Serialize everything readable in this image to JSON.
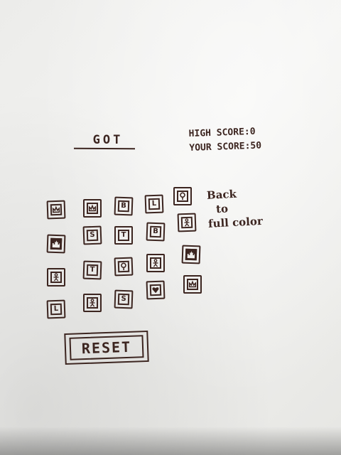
{
  "game": {
    "title": "GOT",
    "high_score_label": "HIGH SCORE:",
    "high_score": "0",
    "your_score_label": "YOUR SCORE:",
    "your_score": "50",
    "note_line1": "Back",
    "note_line2": "to",
    "note_line3": "full color",
    "reset_label": "RESET"
  },
  "tiles": [
    {
      "icon": "crown-icon"
    },
    {
      "icon": "crown-icon"
    },
    {
      "text": "B"
    },
    {
      "text": "L"
    },
    {
      "icon": "tree-icon"
    },
    {
      "icon": "castle-icon",
      "filled": true
    },
    {
      "text": "S"
    },
    {
      "text": "T"
    },
    {
      "text": "B"
    },
    {
      "icon": "figure-icon"
    },
    {
      "icon": "figure-icon"
    },
    {
      "text": "T"
    },
    {
      "icon": "tree-icon"
    },
    {
      "icon": "figure-icon"
    },
    {
      "icon": "castle-icon",
      "filled": true
    },
    {
      "text": "L"
    },
    {
      "icon": "figure-icon"
    },
    {
      "text": "S"
    },
    {
      "icon": "heart-icon"
    },
    {
      "icon": "crown-icon"
    }
  ]
}
